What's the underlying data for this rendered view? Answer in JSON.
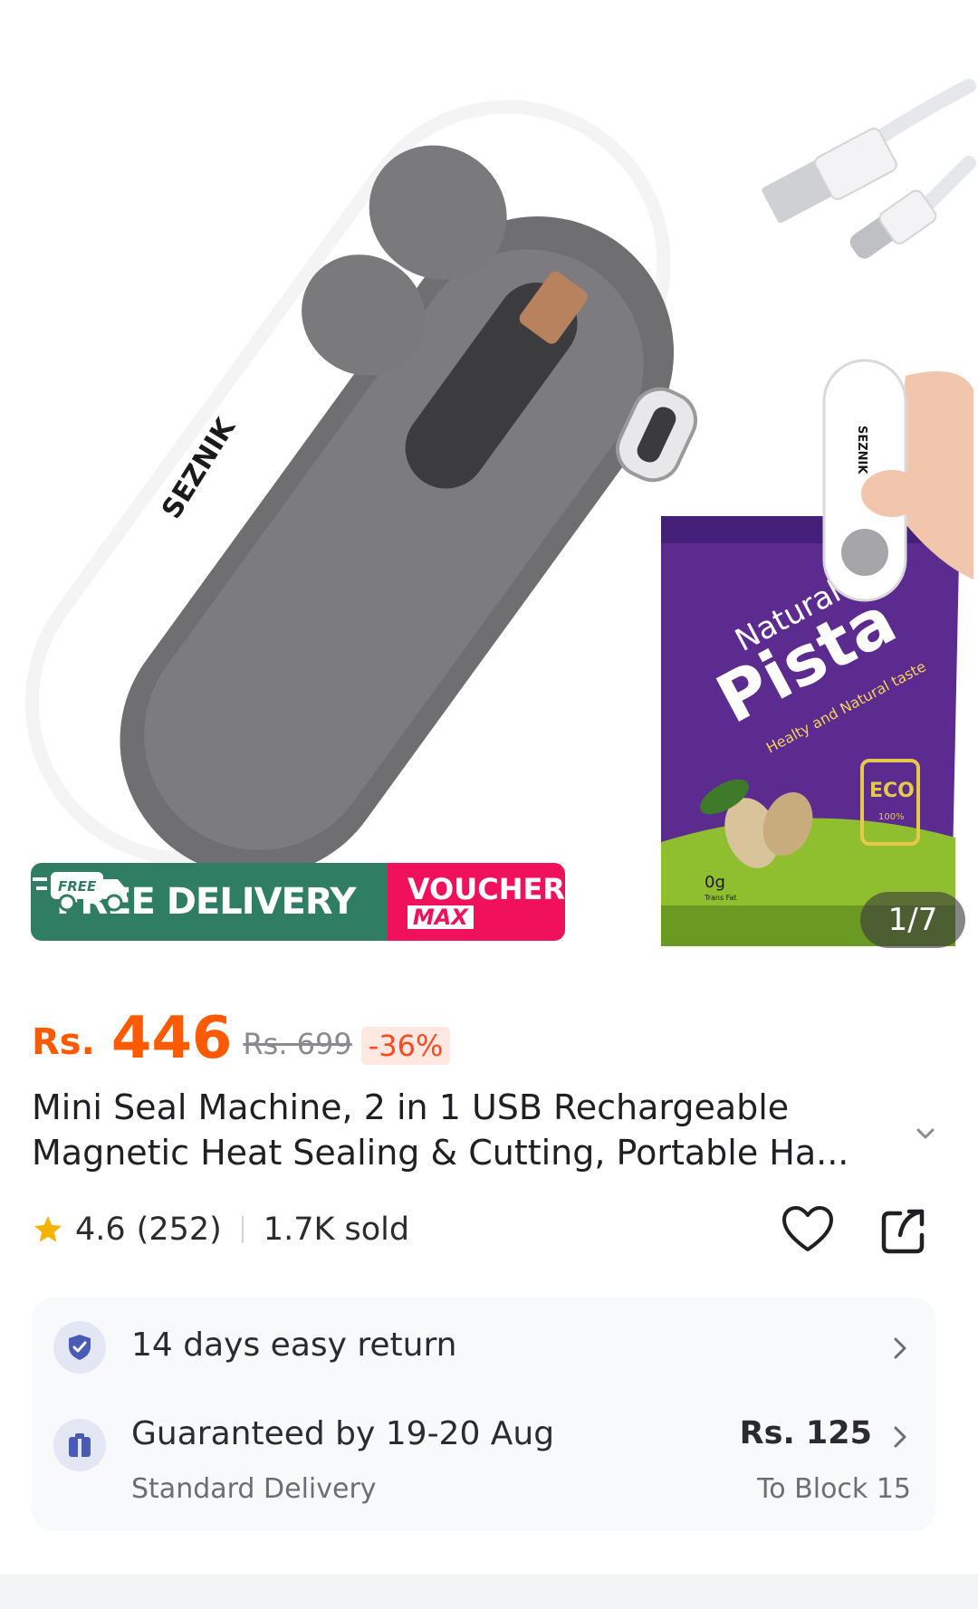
{
  "gallery": {
    "counter": "1/7",
    "brand_on_product": "SEZNIK",
    "package_brand": "Natural",
    "package_name": "Pista",
    "package_tagline": "Healty and Natural taste",
    "package_eco": "ECO",
    "package_eco_sub": "100%",
    "package_fat": "0g",
    "package_fat_sub": "Trans Fat"
  },
  "promo": {
    "free_badge": "FREE",
    "delivery_label": "FREE DELIVERY",
    "voucher_top": "VOUCHER",
    "voucher_bottom": "MAX"
  },
  "price": {
    "currency": "Rs.",
    "current": "446",
    "original": "Rs. 699",
    "discount": "-36%"
  },
  "product": {
    "title": "Mini Seal Machine, 2 in 1 USB Rechargeable Magnetic Heat Sealing & Cutting, Portable Ha..."
  },
  "rating": {
    "score": "4.6",
    "count": "(252)",
    "sold": "1.7K sold"
  },
  "service": {
    "return_label": "14 days easy return",
    "delivery_label": "Guaranteed by 19-20 Aug",
    "delivery_type": "Standard Delivery",
    "delivery_fee": "Rs. 125",
    "delivery_destination": "To Block 15"
  },
  "colors": {
    "accent": "#ff5a00",
    "free_delivery_bg": "#2f7d63",
    "voucher_bg": "#f0105b",
    "star": "#f5b301"
  }
}
